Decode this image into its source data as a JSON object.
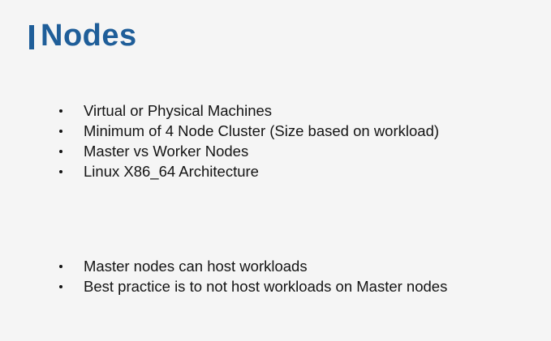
{
  "slide": {
    "title": "Nodes",
    "accent_color": "#1f5e99",
    "bullet_icon": "bullet-dot",
    "group_one": [
      "Virtual or Physical Machines",
      "Minimum of 4 Node Cluster (Size based on workload)",
      "Master vs Worker Nodes",
      "Linux X86_64 Architecture"
    ],
    "group_two": [
      "Master nodes can host workloads",
      "Best practice is to not host workloads on Master nodes"
    ]
  }
}
